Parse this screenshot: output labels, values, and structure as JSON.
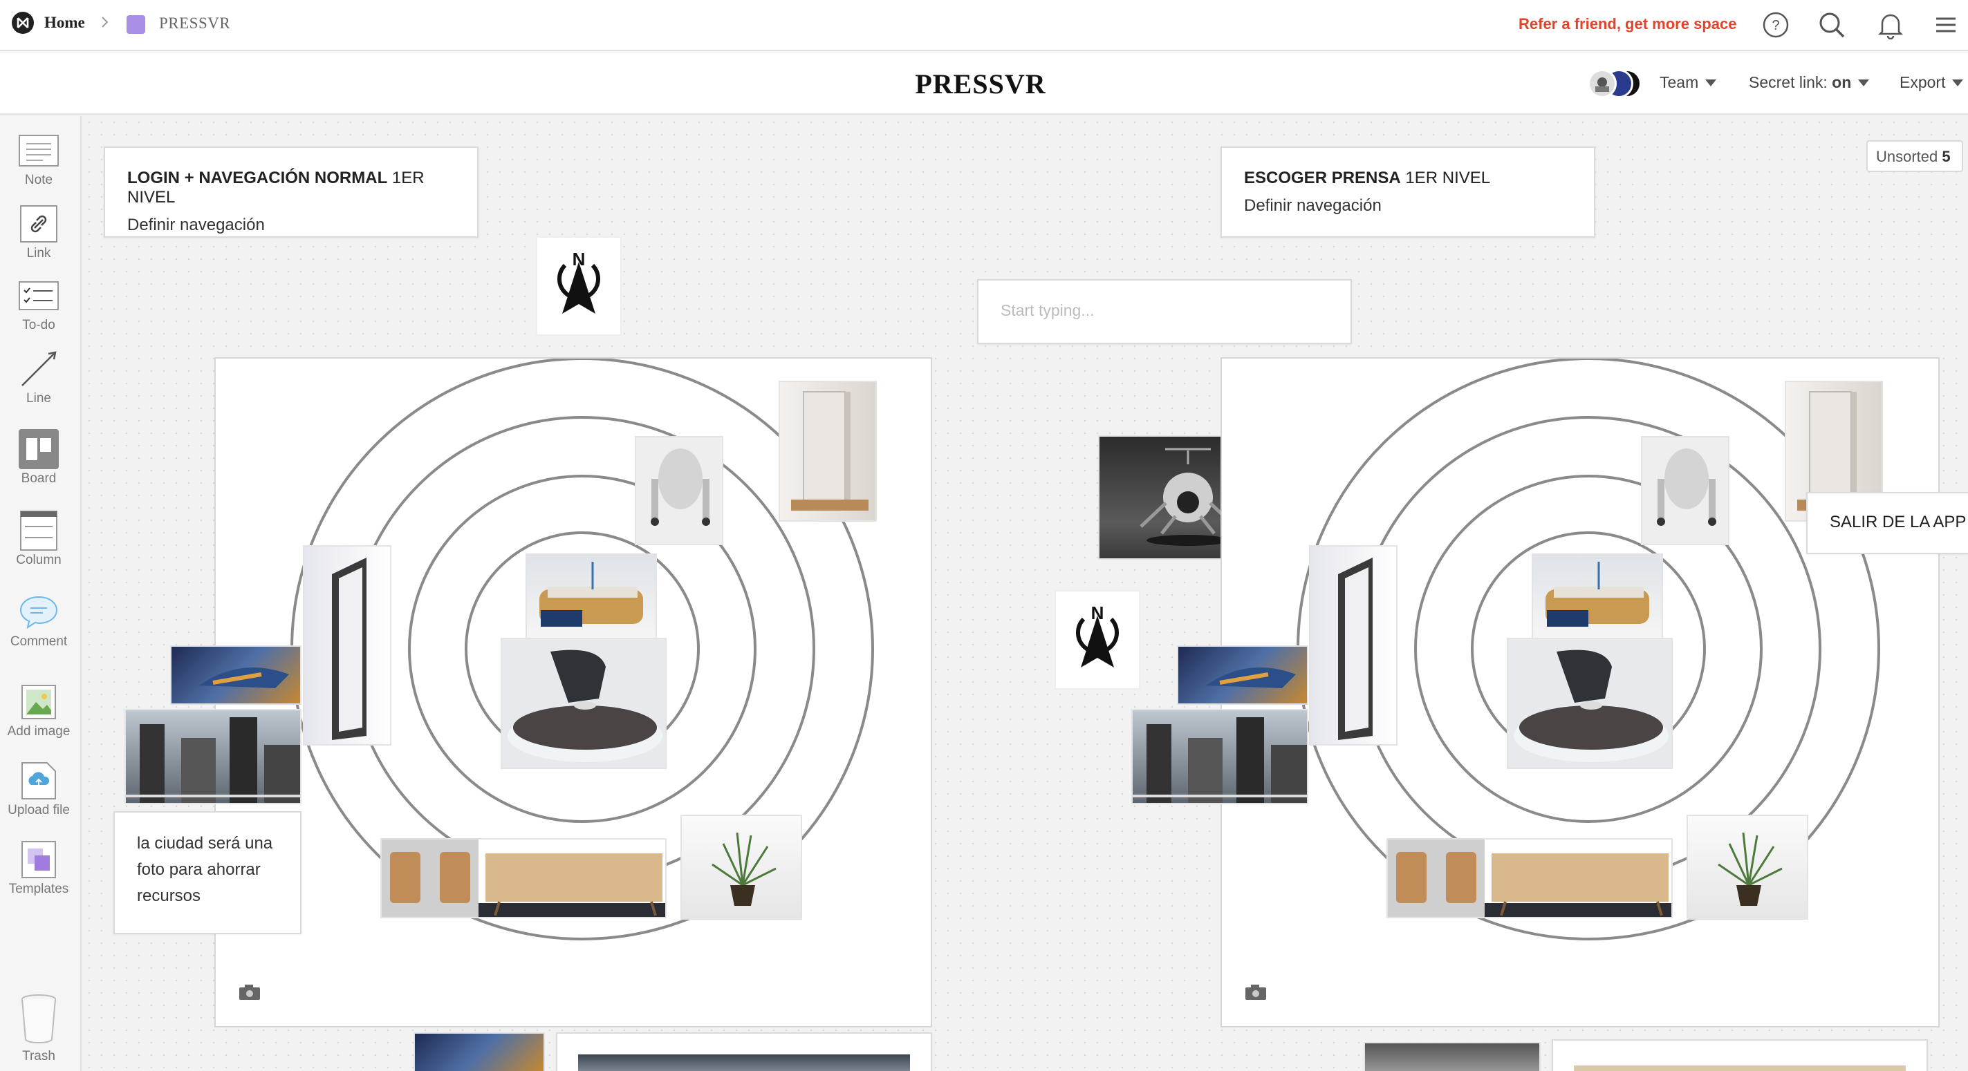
{
  "topbar": {
    "home_label": "Home",
    "board_label": "PRESSVR",
    "refer_label": "Refer a friend, get more space",
    "icons": [
      "help-icon",
      "search-icon",
      "bell-icon",
      "menu-icon"
    ]
  },
  "titlebar": {
    "title": "PRESSVR",
    "team_label": "Team",
    "secret_link_label": "Secret link:",
    "secret_link_value": "on",
    "export_label": "Export"
  },
  "sidebar": {
    "tools": [
      {
        "label": "Note"
      },
      {
        "label": "Link"
      },
      {
        "label": "To-do"
      },
      {
        "label": "Line"
      },
      {
        "label": "Board"
      },
      {
        "label": "Column"
      },
      {
        "label": "Comment"
      },
      {
        "label": "Add image"
      },
      {
        "label": "Upload file"
      },
      {
        "label": "Templates"
      }
    ],
    "trash_label": "Trash"
  },
  "canvas": {
    "unsorted_label": "Unsorted",
    "unsorted_count": "5",
    "note_left": {
      "title_bold": "LOGIN + NAVEGACIÓN NORMAL",
      "title_rest": " 1ER NIVEL",
      "subtitle": "Definir navegación"
    },
    "note_right": {
      "title_bold": "ESCOGER PRENSA",
      "title_rest": " 1ER NIVEL",
      "subtitle": "Definir navegación"
    },
    "empty_note_placeholder": "Start typing...",
    "city_note": "la ciudad será una foto para ahorrar recursos",
    "exit_note": "SALIR DE LA APP",
    "compass_letter": "N"
  },
  "colors": {
    "accent_red": "#e2432b",
    "board_swatch": "#a98ee6"
  }
}
